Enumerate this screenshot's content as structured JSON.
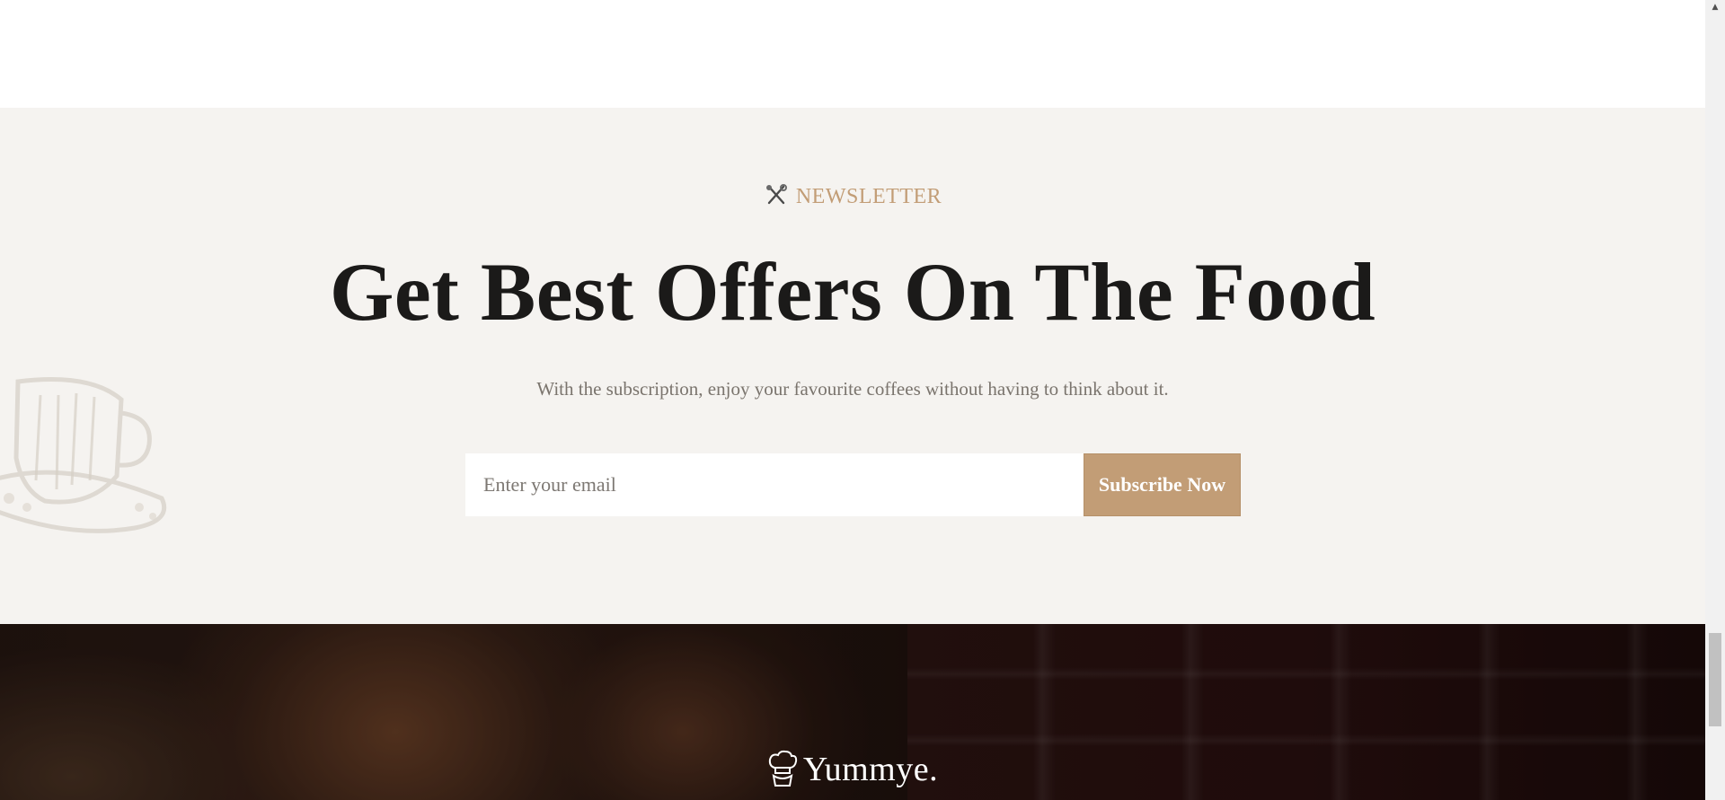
{
  "newsletter": {
    "eyebrow": "NEWSLETTER",
    "eyebrow_icon": "utensils-icon",
    "headline": "Get Best Offers On The Food",
    "subtext": "With the subscription, enjoy your favourite coffees without having to think about it.",
    "email_placeholder": "Enter your email",
    "email_value": "",
    "subscribe_label": "Subscribe Now",
    "accent_color": "#c29d76",
    "background_color": "#f5f3f0",
    "decor_icon": "coffee-cup-sketch-icon"
  },
  "footer": {
    "brand": "Yummye.",
    "brand_icon": "chef-hat-icon"
  },
  "scrollbar": {
    "up_arrow": "▲"
  }
}
